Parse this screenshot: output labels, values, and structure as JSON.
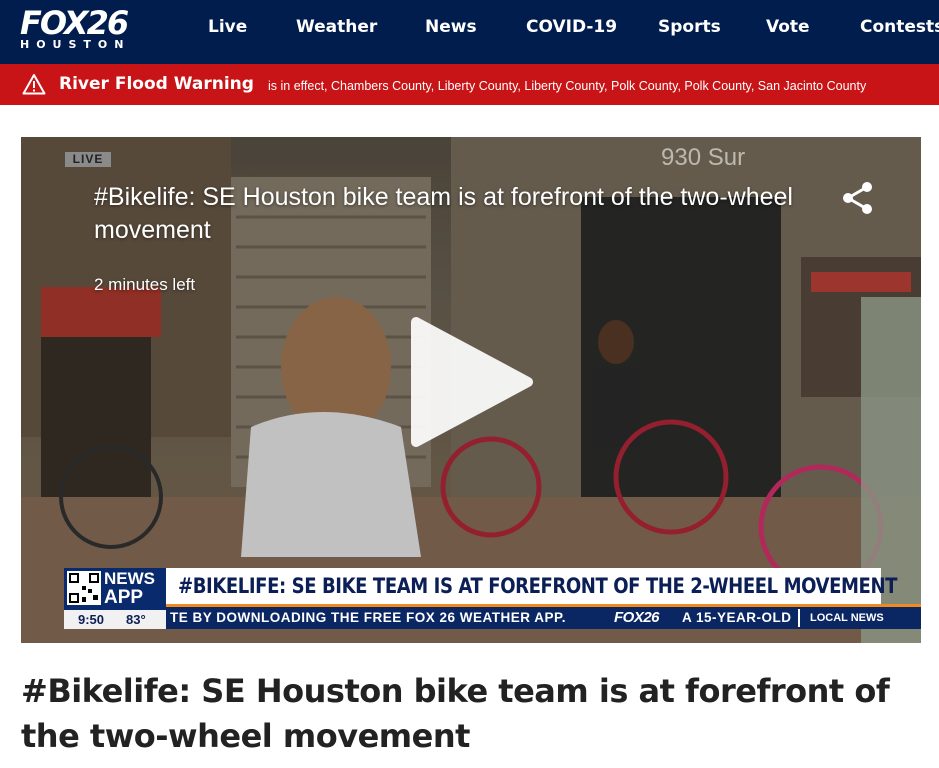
{
  "header": {
    "logo_main": "FOX26",
    "logo_sub": "HOUSTON",
    "nav": [
      "Live",
      "Weather",
      "News",
      "COVID-19",
      "Sports",
      "Vote",
      "Contests"
    ]
  },
  "alert": {
    "icon": "warning-triangle-icon",
    "title": "River Flood Warning",
    "detail": "is in effect, Chambers County, Liberty County, Liberty County, Polk County, Polk County, San Jacinto County"
  },
  "video": {
    "live_badge": "LIVE",
    "title": "#Bikelife: SE Houston bike team is at forefront of the two-wheel movement",
    "time_left": "2 minutes left",
    "share_icon": "share-icon",
    "play_icon": "play-icon",
    "background_sign": "930 Sur",
    "lower_third": {
      "app_line1": "NEWS",
      "app_line2": "APP",
      "headline": "#BIKELIFE: SE BIKE TEAM IS AT FOREFRONT OF THE 2-WHEEL MOVEMENT",
      "time": "9:50",
      "temp": "83°",
      "ticker": "TE BY DOWNLOADING THE FREE FOX 26 WEATHER APP.",
      "ticker_brand": "FOX26",
      "ticker2": "A 15-YEAR-OLD",
      "local_news": "LOCAL NEWS"
    }
  },
  "article": {
    "title": "#Bikelife: SE Houston bike team is at forefront of the two-wheel movement"
  },
  "colors": {
    "header_bg": "#011d4d",
    "alert_bg": "#c81416",
    "ticker_bg": "#0b2763",
    "accent_orange": "#f08a1c"
  }
}
